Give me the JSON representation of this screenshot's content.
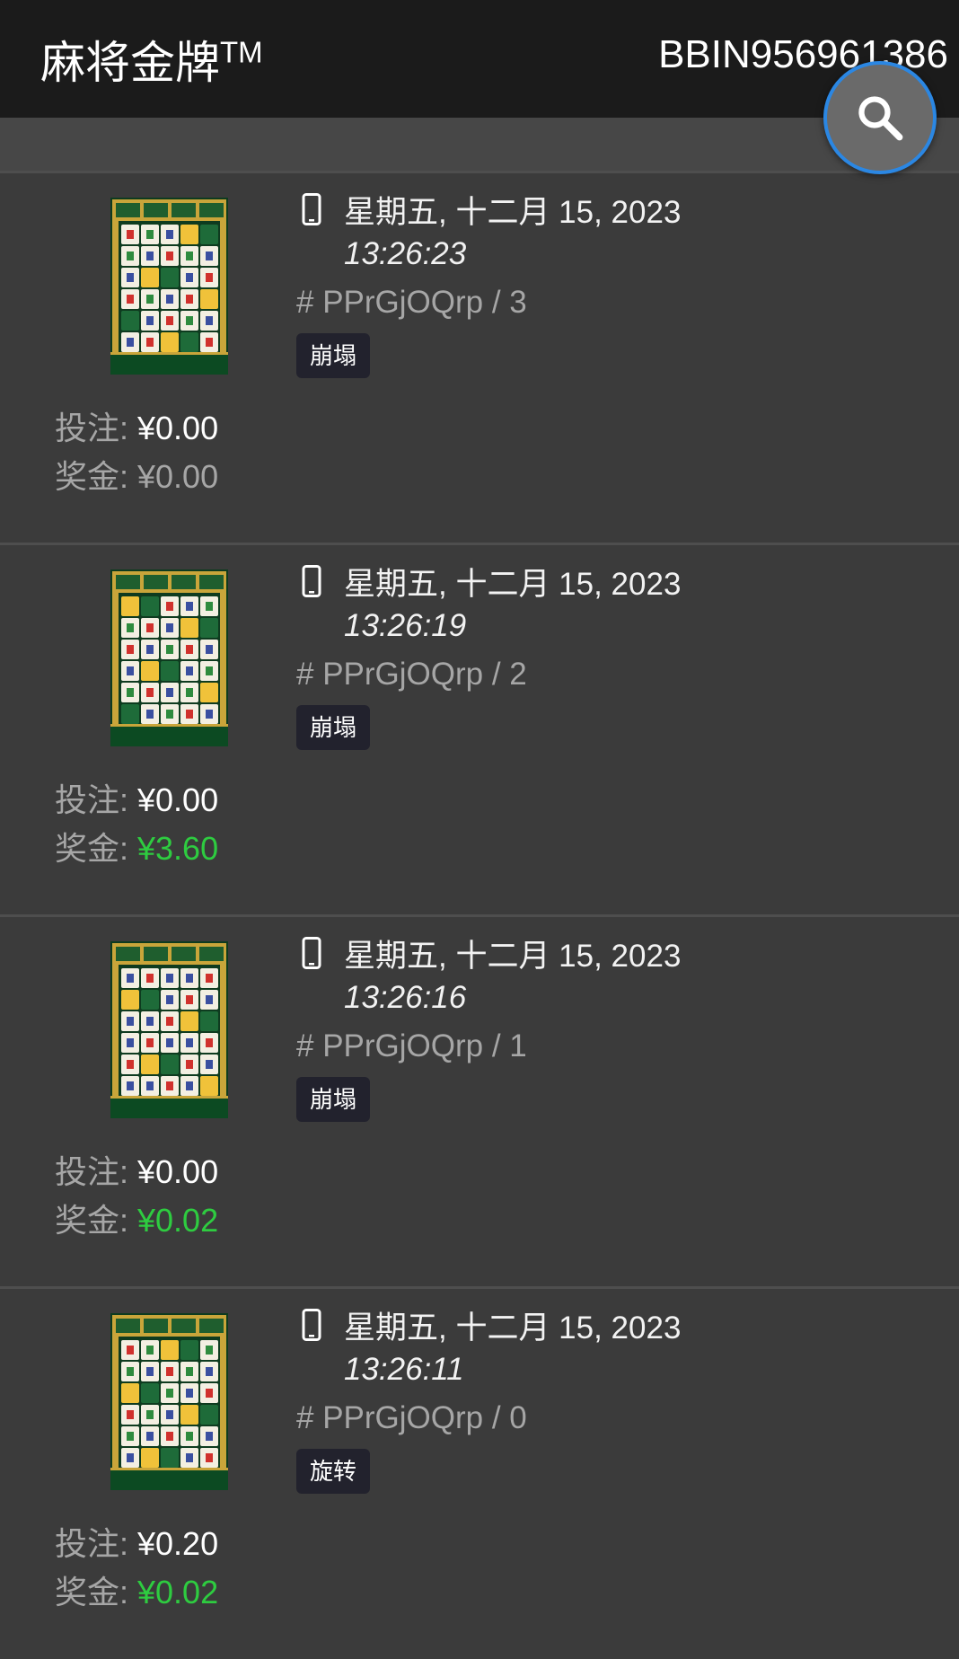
{
  "header": {
    "title": "麻将金牌",
    "title_tm": "TM",
    "account": "BBIN956961386"
  },
  "search": {
    "icon": "search-icon"
  },
  "labels": {
    "bet": "投注: ",
    "win": "奖金: "
  },
  "records": [
    {
      "date": "星期五, 十二月 15, 2023",
      "time": "13:26:23",
      "round": "# PPrGjOQrp / 3",
      "tag": "崩塌",
      "bet": "¥0.00",
      "win": "¥0.00",
      "win_highlight": false
    },
    {
      "date": "星期五, 十二月 15, 2023",
      "time": "13:26:19",
      "round": "# PPrGjOQrp / 2",
      "tag": "崩塌",
      "bet": "¥0.00",
      "win": "¥3.60",
      "win_highlight": true
    },
    {
      "date": "星期五, 十二月 15, 2023",
      "time": "13:26:16",
      "round": "# PPrGjOQrp / 1",
      "tag": "崩塌",
      "bet": "¥0.00",
      "win": "¥0.02",
      "win_highlight": true
    },
    {
      "date": "星期五, 十二月 15, 2023",
      "time": "13:26:11",
      "round": "# PPrGjOQrp / 0",
      "tag": "旋转",
      "bet": "¥0.20",
      "win": "¥0.02",
      "win_highlight": true
    }
  ],
  "colors": {
    "header_bg": "#1b1b1b",
    "record_bg": "#3b3b3b",
    "win_green": "#2ecc40",
    "search_ring": "#2b87e3"
  }
}
